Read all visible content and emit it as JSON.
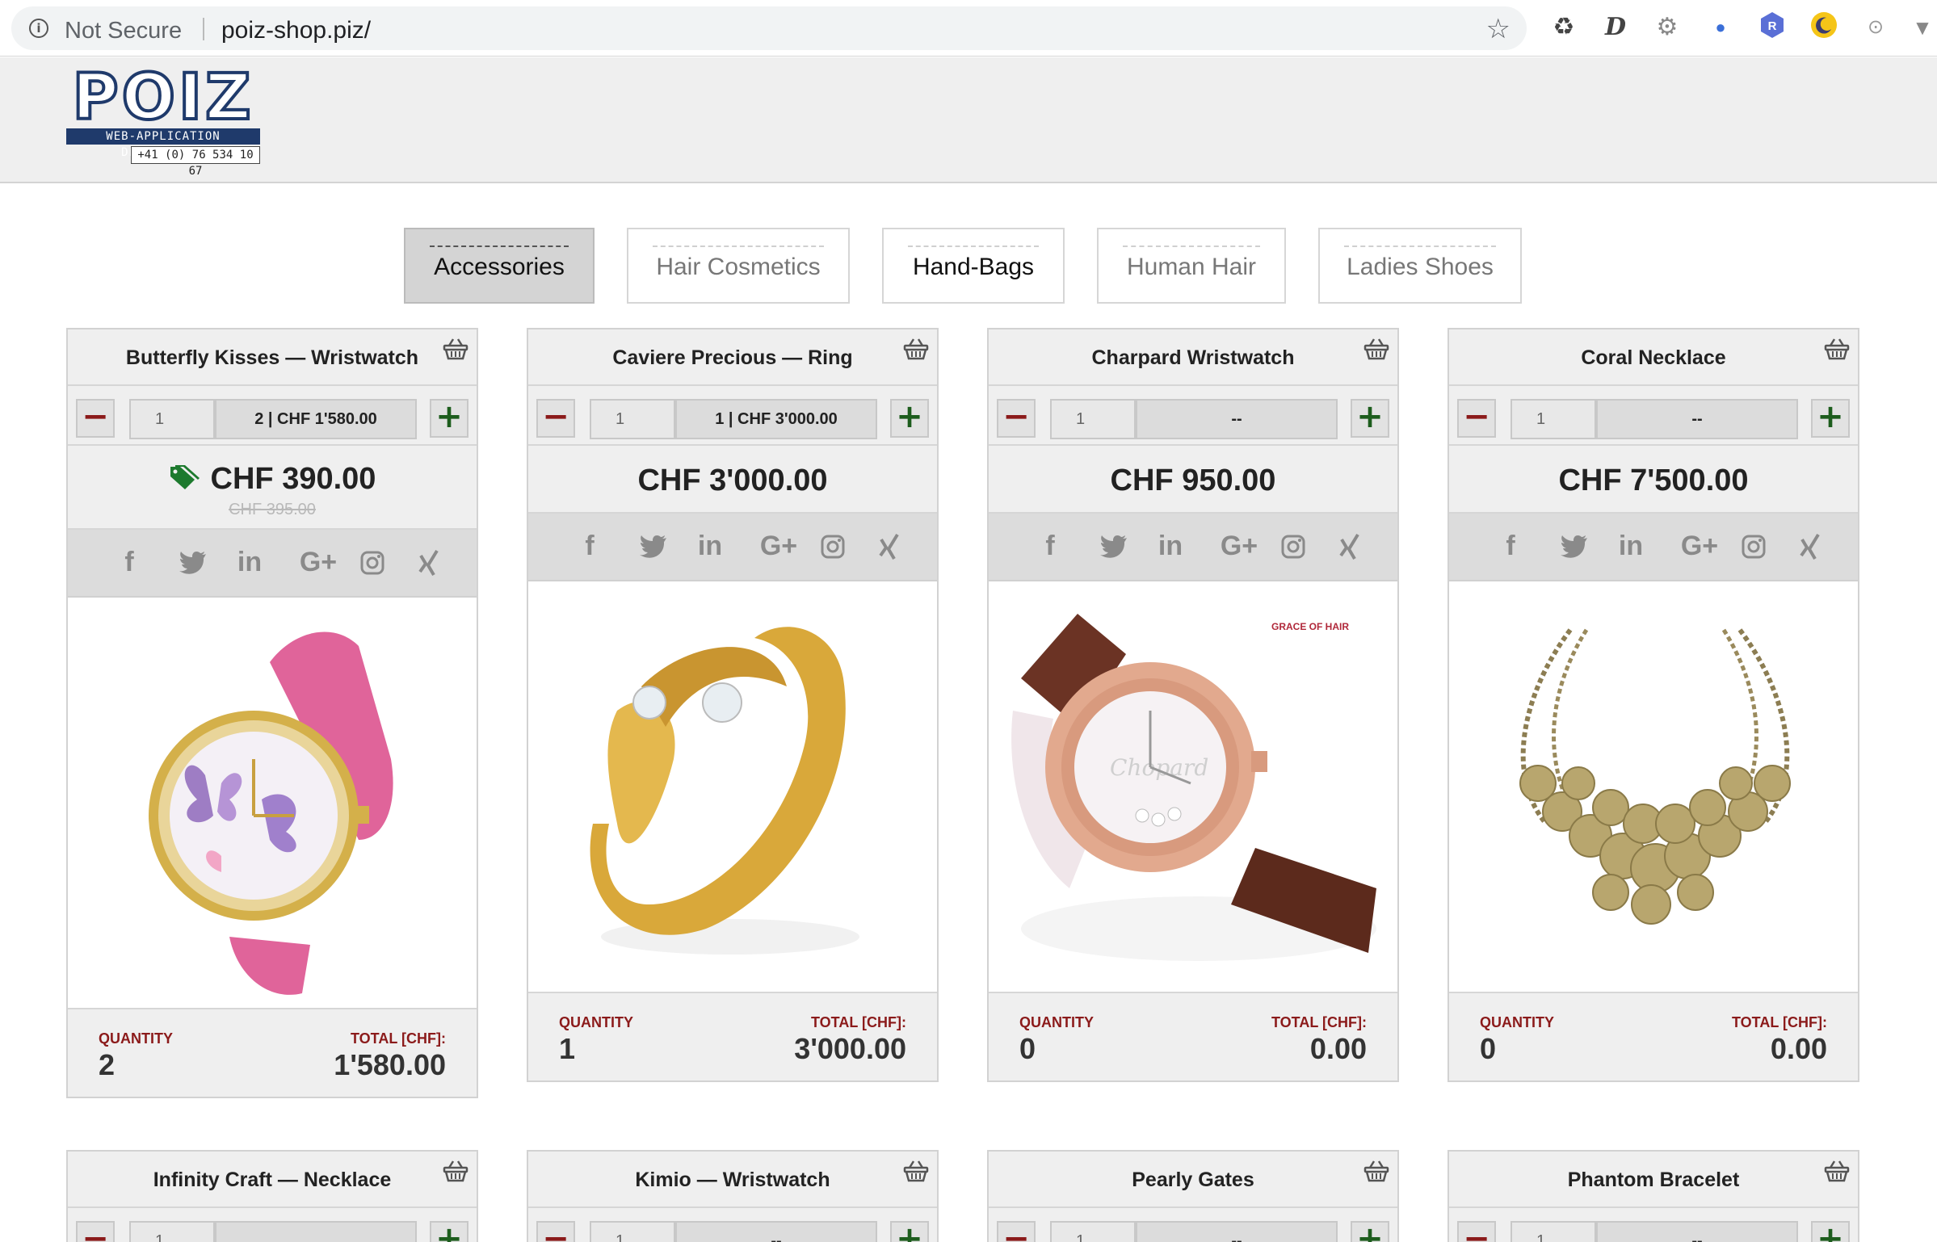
{
  "browser": {
    "security_label": "Not Secure",
    "url": "poiz-shop.piz/",
    "extensions": [
      "recycle-icon",
      "d-icon",
      "gear-icon",
      "dots-icon",
      "r-icon",
      "moon-icon",
      "code-icon",
      "dropdown-icon"
    ]
  },
  "logo": {
    "text": "POIZ",
    "tagline": "WEB-APPLICATION DEVELOPMENT",
    "phone": "+41 (0) 76 534 10 67",
    "brand_color": "#1f3a6b"
  },
  "tabs": [
    {
      "label": "Accessories",
      "active": true
    },
    {
      "label": "Hair Cosmetics",
      "active": false
    },
    {
      "label": "Hand-Bags",
      "active": false
    },
    {
      "label": "Human Hair",
      "active": false
    },
    {
      "label": "Ladies Shoes",
      "active": false
    }
  ],
  "social": [
    "f",
    "t",
    "in",
    "G+",
    "ig",
    "X"
  ],
  "products": [
    {
      "title": "Butterfly Kisses — Wristwatch",
      "qty_input": "1",
      "summary": "2  |  CHF 1'580.00",
      "price": "CHF 390.00",
      "old_price": "CHF 395.00",
      "on_sale": true,
      "quantity_label": "QUANTITY",
      "total_label": "TOTAL [CHF]:",
      "quantity": "2",
      "total": "1'580.00"
    },
    {
      "title": "Caviere Precious — Ring",
      "qty_input": "1",
      "summary": "1  |  CHF 3'000.00",
      "price": "CHF 3'000.00",
      "on_sale": false,
      "quantity_label": "QUANTITY",
      "total_label": "TOTAL [CHF]:",
      "quantity": "1",
      "total": "3'000.00"
    },
    {
      "title": "Charpard Wristwatch",
      "qty_input": "1",
      "summary": "--",
      "price": "CHF 950.00",
      "on_sale": false,
      "image_watermark": "GRACE OF HAIR",
      "quantity_label": "QUANTITY",
      "total_label": "TOTAL [CHF]:",
      "quantity": "0",
      "total": "0.00"
    },
    {
      "title": "Coral Necklace",
      "qty_input": "1",
      "summary": "--",
      "price": "CHF 7'500.00",
      "on_sale": false,
      "quantity_label": "QUANTITY",
      "total_label": "TOTAL [CHF]:",
      "quantity": "0",
      "total": "0.00"
    }
  ],
  "products_row2": [
    {
      "title": "Infinity Craft — Necklace",
      "summary": ""
    },
    {
      "title": "Kimio — Wristwatch",
      "summary": "--"
    },
    {
      "title": "Pearly Gates",
      "summary": "--"
    },
    {
      "title": "Phantom Bracelet",
      "summary": "--"
    }
  ],
  "colors": {
    "minus": "#8b1a1a",
    "plus": "#1d5d1d",
    "sale_tag": "#1d7a2e"
  }
}
